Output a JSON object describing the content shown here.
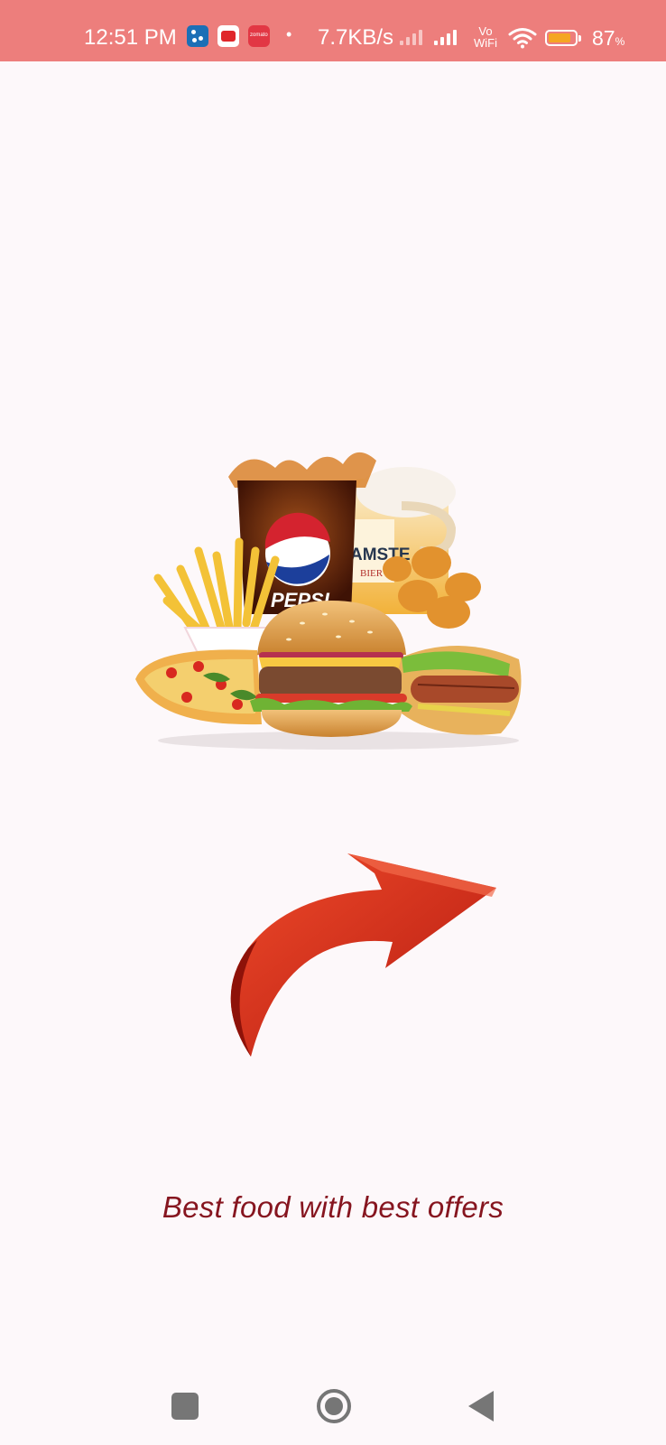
{
  "status_bar": {
    "time": "12:51 PM",
    "app_icons": [
      "dominos-icon",
      "youtube-icon",
      "zomato-icon"
    ],
    "zomato_text": "zomato",
    "dot": "•",
    "net_speed": "7.7KB/s",
    "vowifi_top": "Vo",
    "vowifi_bottom": "WiFi",
    "battery_percent": "87",
    "battery_unit": "%",
    "battery_level": 0.87,
    "background_color": "#ed7e7c"
  },
  "hero": {
    "cup_brand": "PEPSI",
    "can_brand": "AMSTE",
    "can_sub": "BIER"
  },
  "tagline": "Best food with best offers",
  "colors": {
    "tagline": "#86151f",
    "arrow": "#d92d1b",
    "nav_icons": "#767676"
  },
  "nav_bar": {
    "buttons": [
      "recent-apps",
      "home",
      "back"
    ]
  }
}
